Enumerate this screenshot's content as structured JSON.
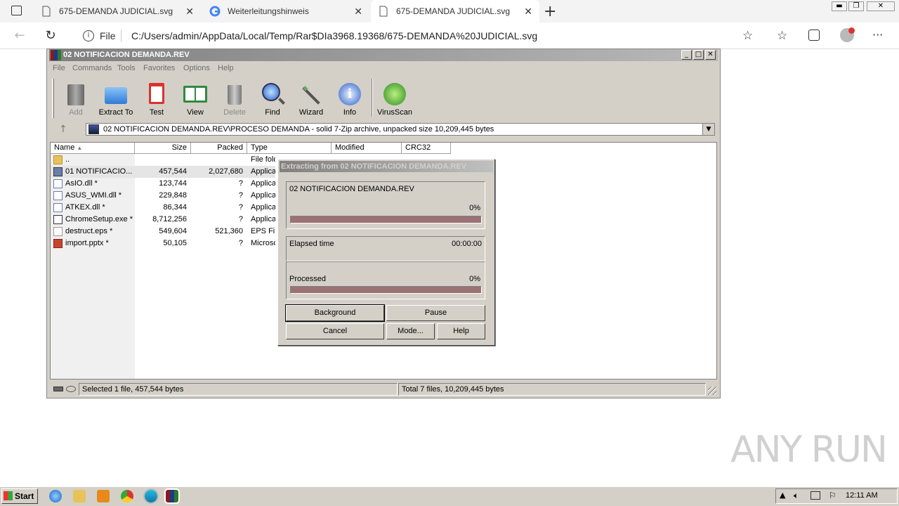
{
  "browser": {
    "tabs": [
      {
        "title": "675-DEMANDA JUDICIAL.svg",
        "active": false
      },
      {
        "title": "Weiterleitungshinweis",
        "active": false
      },
      {
        "title": "675-DEMANDA JUDICIAL.svg",
        "active": true
      }
    ],
    "file_label": "File",
    "url": "C:/Users/admin/AppData/Local/Temp/Rar$DIa3968.19368/675-DEMANDA%20JUDICIAL.svg"
  },
  "winrar": {
    "title": "02 NOTIFICACION DEMANDA.REV",
    "menu": [
      "File",
      "Commands",
      "Tools",
      "Favorites",
      "Options",
      "Help"
    ],
    "toolbar": [
      {
        "label": "Add",
        "icon": "add-archive-icon",
        "enabled": false
      },
      {
        "label": "Extract To",
        "icon": "extract-folder-icon",
        "enabled": true
      },
      {
        "label": "Test",
        "icon": "test-clipboard-icon",
        "enabled": true
      },
      {
        "label": "View",
        "icon": "view-book-icon",
        "enabled": true
      },
      {
        "label": "Delete",
        "icon": "trash-icon",
        "enabled": false
      },
      {
        "label": "Find",
        "icon": "magnifier-icon",
        "enabled": true
      },
      {
        "label": "Wizard",
        "icon": "wand-icon",
        "enabled": true
      },
      {
        "label": "Info",
        "icon": "info-icon",
        "enabled": true
      },
      {
        "label": "VirusScan",
        "icon": "virus-scan-icon",
        "enabled": true
      }
    ],
    "path": "02 NOTIFICACION DEMANDA.REV\\PROCESO DEMANDA - solid 7-Zip archive, unpacked size 10,209,445 bytes",
    "columns": [
      "Name",
      "Size",
      "Packed",
      "Type",
      "Modified",
      "CRC32"
    ],
    "files": [
      {
        "name": "..",
        "size": "",
        "packed": "",
        "type": "File fold",
        "icon": "folder-icon",
        "selected": false
      },
      {
        "name": "01 NOTIFICACIO...",
        "size": "457,544",
        "packed": "2,027,680",
        "type": "Applicat",
        "icon": "exe-icon",
        "selected": true
      },
      {
        "name": "AsIO.dll *",
        "size": "123,744",
        "packed": "?",
        "type": "Applicat",
        "icon": "dll-icon",
        "selected": false
      },
      {
        "name": "ASUS_WMI.dll *",
        "size": "229,848",
        "packed": "?",
        "type": "Applicat",
        "icon": "dll-icon",
        "selected": false
      },
      {
        "name": "ATKEX.dll *",
        "size": "86,344",
        "packed": "?",
        "type": "Applicat",
        "icon": "dll-icon",
        "selected": false
      },
      {
        "name": "ChromeSetup.exe *",
        "size": "8,712,256",
        "packed": "?",
        "type": "Applicat",
        "icon": "exe-icon",
        "selected": false
      },
      {
        "name": "destruct.eps *",
        "size": "549,604",
        "packed": "521,360",
        "type": "EPS File",
        "icon": "file-icon",
        "selected": false
      },
      {
        "name": "import.pptx *",
        "size": "50,105",
        "packed": "?",
        "type": "Microso",
        "icon": "pptx-icon",
        "selected": false
      }
    ],
    "status_left": "Selected 1 file, 457,544 bytes",
    "status_right": "Total 7 files, 10,209,445 bytes"
  },
  "dialog": {
    "title": "Extracting from 02 NOTIFICACION DEMANDA.REV",
    "archive_name": "02 NOTIFICACION DEMANDA.REV",
    "file_progress_text": "0%",
    "file_progress": 0,
    "elapsed_label": "Elapsed time",
    "elapsed_value": "00:00:00",
    "processed_label": "Processed",
    "processed_text": "0%",
    "processed_progress": 0,
    "buttons": {
      "background": "Background",
      "pause": "Pause",
      "cancel": "Cancel",
      "mode": "Mode...",
      "help": "Help"
    }
  },
  "taskbar": {
    "start": "Start",
    "clock": "12:11 AM"
  },
  "watermark": "ANY RUN"
}
